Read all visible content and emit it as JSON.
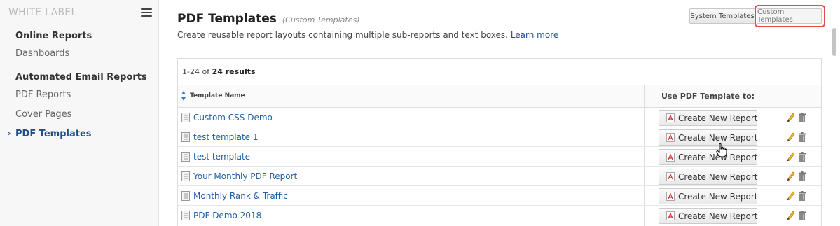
{
  "sidebar": {
    "brand": "WHITE LABEL",
    "items": [
      {
        "label": "Online Reports",
        "type": "heading"
      },
      {
        "label": "Dashboards",
        "type": "link"
      },
      {
        "label": "Automated Email Reports",
        "type": "heading"
      },
      {
        "label": "PDF Reports",
        "type": "link"
      },
      {
        "label": "Cover Pages",
        "type": "link"
      },
      {
        "label": "PDF Templates",
        "type": "active"
      }
    ]
  },
  "header": {
    "title": "PDF Templates",
    "subtitle": "(Custom Templates)",
    "description": "Create reusable report layouts containing multiple sub-reports and text boxes.",
    "learn_more": "Learn more",
    "system_button": "System Templates",
    "custom_button": "Custom Templates"
  },
  "table": {
    "results_prefix": "1-24 of ",
    "results_bold": "24 results",
    "col_name": "Template Name",
    "col_use": "Use PDF Template to:",
    "rows": [
      {
        "name": "Custom CSS Demo",
        "action": "Create New Report"
      },
      {
        "name": "test template 1",
        "action": "Create New Report"
      },
      {
        "name": "test template",
        "action": "Create New Report"
      },
      {
        "name": "Your Monthly PDF Report",
        "action": "Create New Report"
      },
      {
        "name": "Monthly Rank & Traffic",
        "action": "Create New Report"
      },
      {
        "name": "PDF Demo 2018",
        "action": "Create New Report"
      }
    ]
  },
  "colors": {
    "link": "#1f5fa5",
    "active_nav": "#1f4f8f",
    "highlight": "#e34b4b"
  },
  "icons": [
    "menu-icon",
    "chevron-right-icon",
    "sort-icon",
    "document-icon",
    "pdf-icon",
    "pencil-icon",
    "trash-icon",
    "hand-cursor-icon"
  ]
}
